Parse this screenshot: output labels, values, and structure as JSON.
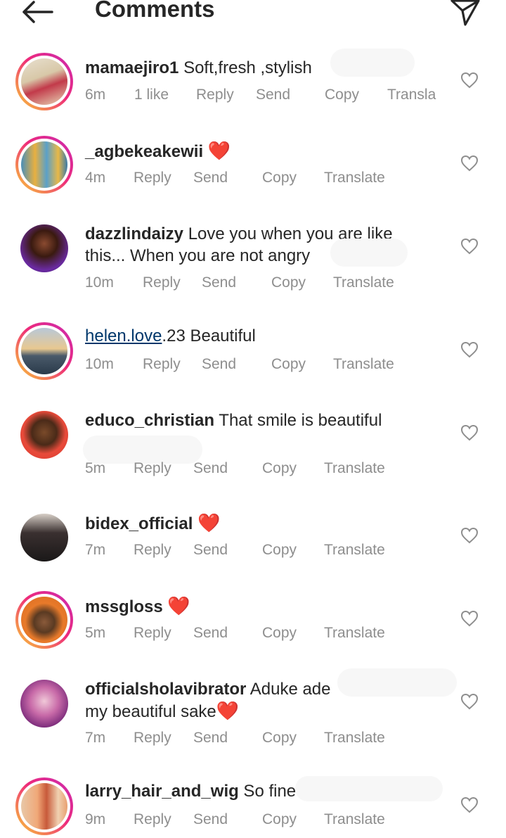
{
  "header": {
    "title": "Comments",
    "back_icon": "arrow-left-icon",
    "share_icon": "paper-plane-icon"
  },
  "comments": [
    {
      "username": "mamaejiro1",
      "text": " Soft,fresh ,stylish",
      "time": "6m",
      "likes": "1 like",
      "reply": "Reply",
      "send": "Send",
      "copy": "Copy",
      "translate": "Transla",
      "story_ring": true
    },
    {
      "username": "_agbekeakewii",
      "text": " ",
      "emoji": "❤️",
      "time": "4m",
      "reply": "Reply",
      "send": "Send",
      "copy": "Copy",
      "translate": "Translate",
      "story_ring": true
    },
    {
      "username": "dazzlindaizy",
      "text": " Love you when you are like this... When you are not angry",
      "time": "10m",
      "reply": "Reply",
      "send": "Send",
      "copy": "Copy",
      "translate": "Translate",
      "story_ring": false
    },
    {
      "mention": "helen.love",
      "username_rest": ".23",
      "text": " Beautiful",
      "time": "10m",
      "reply": "Reply",
      "send": "Send",
      "copy": "Copy",
      "translate": "Translate",
      "story_ring": true
    },
    {
      "username": "educo_christian",
      "text": " That smile is beautiful",
      "time": "5m",
      "reply": "Reply",
      "send": "Send",
      "copy": "Copy",
      "translate": "Translate",
      "story_ring": false
    },
    {
      "username": "bidex_official",
      "text": " ",
      "emoji": "❤️",
      "time": "7m",
      "reply": "Reply",
      "send": "Send",
      "copy": "Copy",
      "translate": "Translate",
      "story_ring": false
    },
    {
      "username": "mssgloss",
      "text": " ",
      "emoji": "❤️",
      "time": "5m",
      "reply": "Reply",
      "send": "Send",
      "copy": "Copy",
      "translate": "Translate",
      "story_ring": true
    },
    {
      "username": "officialsholavibrator",
      "text": " Aduke ade my beautiful sake",
      "emoji": "❤️",
      "time": "7m",
      "reply": "Reply",
      "send": "Send",
      "copy": "Copy",
      "translate": "Translate",
      "story_ring": false
    },
    {
      "username": "larry_hair_and_wig",
      "text": " So fine",
      "time": "9m",
      "reply": "Reply",
      "send": "Send",
      "copy": "Copy",
      "translate": "Translate",
      "story_ring": true
    }
  ]
}
